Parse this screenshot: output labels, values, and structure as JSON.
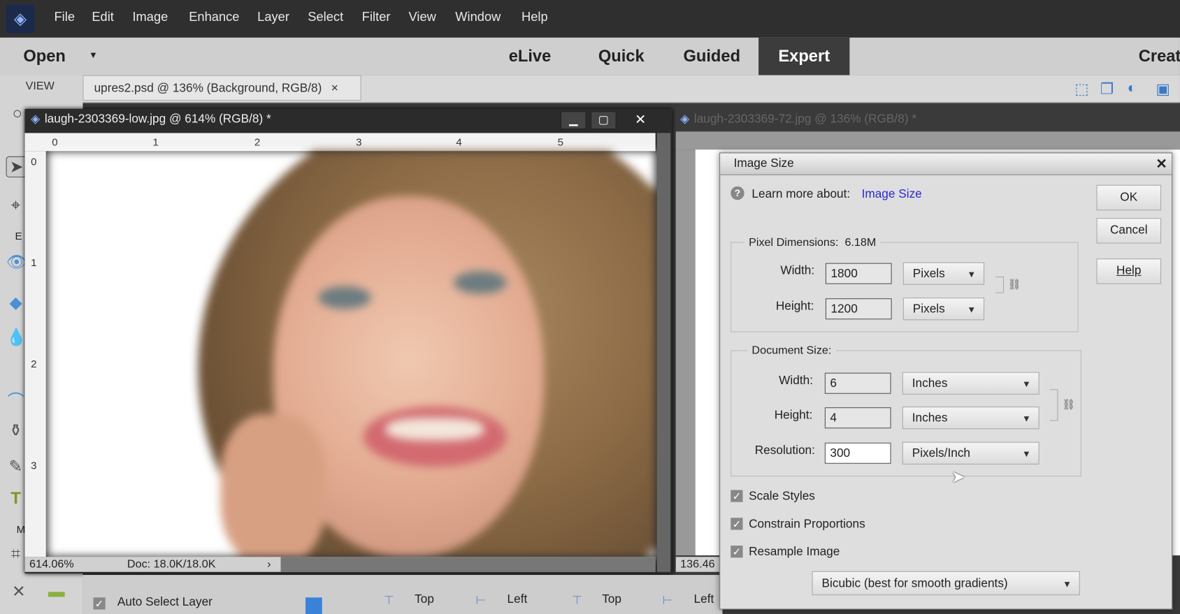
{
  "menubar": {
    "items": [
      "File",
      "Edit",
      "Image",
      "Enhance",
      "Layer",
      "Select",
      "Filter",
      "View",
      "Window",
      "Help"
    ]
  },
  "modebar": {
    "open": "Open",
    "modes": [
      "eLive",
      "Quick",
      "Guided",
      "Expert"
    ],
    "create": "Creat"
  },
  "tabs": {
    "tab1": "upres2.psd @ 136% (Background, RGB/8)",
    "close": "×"
  },
  "toolbox": {
    "view_label": "VIEW",
    "section_e": "E",
    "section_m": "M"
  },
  "doc1": {
    "title": "laugh-2303369-low.jpg @ 614% (RGB/8) *",
    "zoom": "614.06%",
    "doc": "Doc: 18.0K/18.0K",
    "ruler_h": [
      "0",
      "1",
      "2",
      "3",
      "4",
      "5"
    ],
    "ruler_v": [
      "0",
      "1",
      "2",
      "3"
    ]
  },
  "doc2": {
    "title": "laugh-2303369-72.jpg @ 136% (RGB/8) *",
    "zoom": "136.46"
  },
  "dialog": {
    "title": "Image Size",
    "close": "✕",
    "learn_prefix": "Learn more about:",
    "learn_link": "Image Size",
    "ok": "OK",
    "cancel": "Cancel",
    "help": "Help",
    "pixel_dims_label": "Pixel Dimensions:",
    "pixel_dims_value": "6.18M",
    "px_width_label": "Width:",
    "px_width": "1800",
    "px_width_unit": "Pixels",
    "px_height_label": "Height:",
    "px_height": "1200",
    "px_height_unit": "Pixels",
    "doc_size_label": "Document Size:",
    "doc_width_label": "Width:",
    "doc_width": "6",
    "doc_width_unit": "Inches",
    "doc_height_label": "Height:",
    "doc_height": "4",
    "doc_height_unit": "Inches",
    "res_label": "Resolution:",
    "res": "300",
    "res_unit": "Pixels/Inch",
    "scale_styles": "Scale Styles",
    "constrain": "Constrain Proportions",
    "resample": "Resample Image",
    "method": "Bicubic (best for smooth gradients)",
    "link_color": "#2a2ad0"
  },
  "options": {
    "auto_select": "Auto Select Layer",
    "align": [
      "Top",
      "Left",
      "Top",
      "Left"
    ]
  }
}
